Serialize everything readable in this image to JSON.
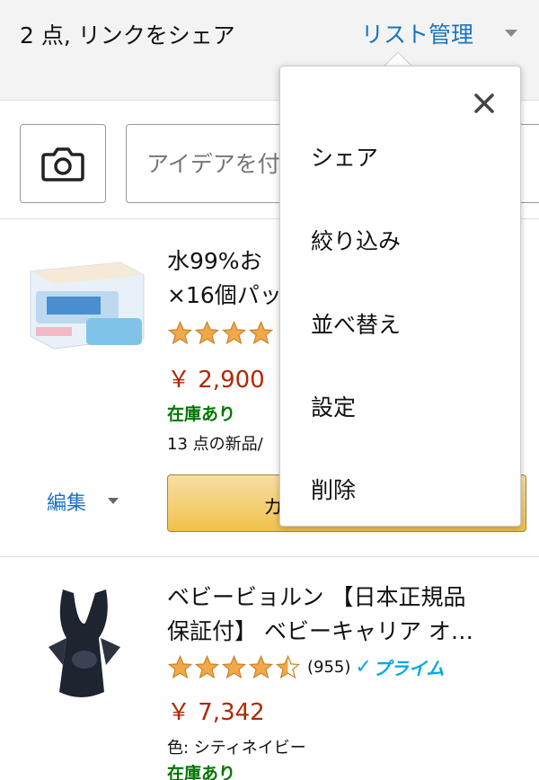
{
  "header": {
    "title": "2 点, リンクをシェア",
    "list_manage": "リスト管理"
  },
  "search": {
    "placeholder": "アイデアを付"
  },
  "items": [
    {
      "title_line1": "水99%お",
      "title_line2": "×16個パッ",
      "rating": 4.5,
      "price": "￥ 2,900",
      "stock": "在庫あり",
      "offers": "13 点の新品/",
      "edit_label": "編集",
      "cart_label": "カ"
    },
    {
      "title_line1": "ベビービョルン 【日本正規品",
      "title_line2": "保証付】 ベビーキャリア オ…",
      "rating": 4.5,
      "reviews": "(955)",
      "prime_label": "プライム",
      "price": "￥ 7,342",
      "color": "色: シティネイビー",
      "stock": "在庫あり"
    }
  ],
  "dropdown": {
    "items": [
      "シェア",
      "絞り込み",
      "並べ替え",
      "設定",
      "削除"
    ]
  },
  "colors": {
    "link": "#1a73c5",
    "price": "#b12704",
    "stock": "#007600",
    "star": "#f3a847",
    "prime": "#00a8e1"
  }
}
